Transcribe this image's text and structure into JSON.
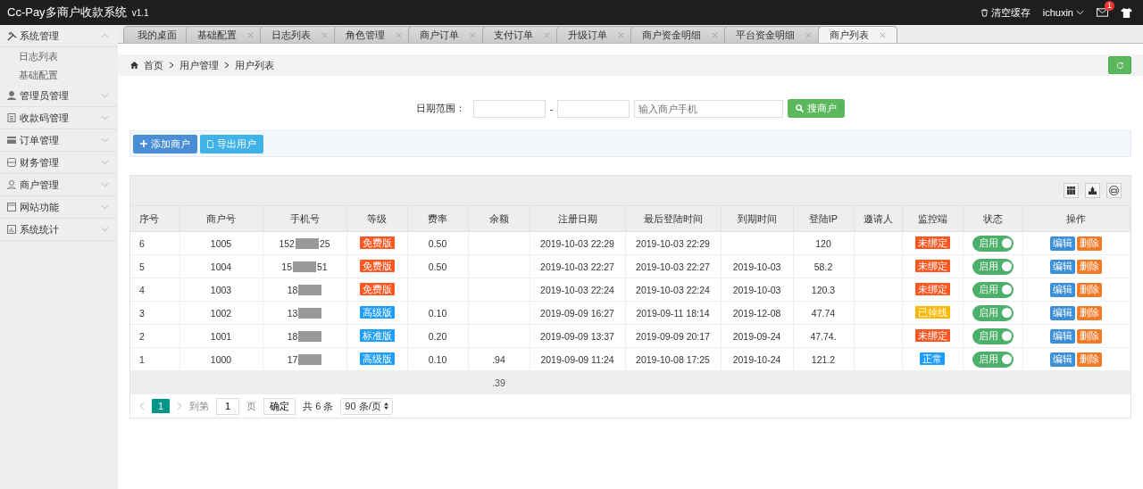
{
  "topbar": {
    "title": "Cc-Pay多商户收款系统",
    "version": "v1.1",
    "clear_cache": "清空缓存",
    "user": "ichuxin",
    "mail_badge": "1"
  },
  "sidebar": {
    "items": [
      {
        "label": "系统管理",
        "kind": "tools",
        "expanded": true,
        "children": [
          {
            "label": "日志列表"
          },
          {
            "label": "基础配置"
          }
        ]
      },
      {
        "label": "管理员管理",
        "kind": "person",
        "expanded": false
      },
      {
        "label": "收款码管理",
        "kind": "doc",
        "expanded": false
      },
      {
        "label": "订单管理",
        "kind": "card",
        "expanded": false
      },
      {
        "label": "财务管理",
        "kind": "db",
        "expanded": false
      },
      {
        "label": "商户管理",
        "kind": "person2",
        "expanded": false
      },
      {
        "label": "网站功能",
        "kind": "window",
        "expanded": false
      },
      {
        "label": "系统统计",
        "kind": "chart",
        "expanded": false
      }
    ]
  },
  "tabs": [
    {
      "label": "我的桌面",
      "closable": false,
      "selected": false
    },
    {
      "label": "基础配置",
      "closable": true,
      "selected": false
    },
    {
      "label": "日志列表",
      "closable": true,
      "selected": false
    },
    {
      "label": "角色管理",
      "closable": true,
      "selected": false
    },
    {
      "label": "商户订单",
      "closable": true,
      "selected": false
    },
    {
      "label": "支付订单",
      "closable": true,
      "selected": false
    },
    {
      "label": "升级订单",
      "closable": true,
      "selected": false
    },
    {
      "label": "商户资金明细",
      "closable": true,
      "selected": false
    },
    {
      "label": "平台资金明细",
      "closable": true,
      "selected": false
    },
    {
      "label": "商户列表",
      "closable": true,
      "selected": true
    }
  ],
  "breadcrumb": [
    "首页",
    "用户管理",
    "用户列表"
  ],
  "search": {
    "label": "日期范围：",
    "dash": "-",
    "phone_placeholder": "输入商户手机",
    "button": "搜商户"
  },
  "actions": [
    "添加商户",
    "导出用户"
  ],
  "table": {
    "columns": [
      "序号",
      "商户号",
      "手机号",
      "等级",
      "费率",
      "余额",
      "注册日期",
      "最后登陆时间",
      "到期时间",
      "登陆IP",
      "邀请人",
      "监控端",
      "状态",
      "操作"
    ],
    "rows": [
      {
        "no": "6",
        "id": "1005",
        "phone": "152",
        "phone_end": "25",
        "level": {
          "label": "免费版",
          "color": "#ff5722"
        },
        "rate": "0.50",
        "balance": "",
        "registered": "2019-10-03 22:29",
        "last_login": "2019-10-03 22:29",
        "expires": "",
        "ip": "120",
        "monitor": {
          "label": "未绑定",
          "color": "#ff5722"
        },
        "status": "启用",
        "on": true,
        "actions": [
          "编辑",
          "删除"
        ]
      },
      {
        "no": "5",
        "id": "1004",
        "phone": "15",
        "phone_end": "51",
        "level": {
          "label": "免费版",
          "color": "#ff5722"
        },
        "rate": "0.50",
        "balance": "",
        "registered": "2019-10-03 22:27",
        "last_login": "2019-10-03 22:27",
        "expires": "2019-10-03",
        "ip": "58.2",
        "monitor": {
          "label": "未绑定",
          "color": "#ff5722"
        },
        "status": "启用",
        "on": true,
        "actions": [
          "编辑",
          "删除"
        ]
      },
      {
        "no": "4",
        "id": "1003",
        "phone": "18",
        "phone_end": "",
        "level": {
          "label": "免费版",
          "color": "#ff5722"
        },
        "rate": "",
        "balance": "",
        "registered": "2019-10-03 22:24",
        "last_login": "2019-10-03 22:24",
        "expires": "2019-10-03",
        "ip": "120.3",
        "monitor": {
          "label": "未绑定",
          "color": "#ff5722"
        },
        "status": "启用",
        "on": true,
        "actions": [
          "编辑",
          "删除"
        ]
      },
      {
        "no": "3",
        "id": "1002",
        "phone": "13",
        "phone_end": "",
        "level": {
          "label": "高级版",
          "color": "#1e9fff"
        },
        "rate": "0.10",
        "balance": "",
        "registered": "2019-09-09 16:27",
        "last_login": "2019-09-11 18:14",
        "expires": "2019-12-08",
        "ip": "47.74",
        "monitor": {
          "label": "已掉线",
          "color": "#ffb800"
        },
        "status": "启用",
        "on": true,
        "actions": [
          "编辑",
          "删除"
        ]
      },
      {
        "no": "2",
        "id": "1001",
        "phone": "18",
        "phone_end": "",
        "level": {
          "label": "标准版",
          "color": "#1e9fff"
        },
        "rate": "0.20",
        "balance": "",
        "registered": "2019-09-09 13:37",
        "last_login": "2019-09-09 20:17",
        "expires": "2019-09-24",
        "ip": "47.74.",
        "monitor": {
          "label": "未绑定",
          "color": "#ff5722"
        },
        "status": "启用",
        "on": true,
        "actions": [
          "编辑",
          "删除"
        ]
      },
      {
        "no": "1",
        "id": "1000",
        "phone": "17",
        "phone_end": "",
        "level": {
          "label": "高级版",
          "color": "#1e9fff"
        },
        "rate": "0.10",
        "balance": ".94",
        "registered": "2019-09-09 11:24",
        "last_login": "2019-10-08 17:25",
        "expires": "2019-10-24",
        "ip": "121.2",
        "monitor": {
          "label": "正常",
          "color": "#1e9fff"
        },
        "status": "启用",
        "on": true,
        "actions": [
          "编辑",
          "删除"
        ]
      }
    ],
    "total_balance": ".39"
  },
  "pagination": {
    "pages": [
      {
        "label": "1",
        "selected": true
      }
    ],
    "goto": "到第",
    "page_input": "1",
    "page_unit": "页",
    "confirm": "确定",
    "total": "共 6 条",
    "per_page": "90 条/页"
  }
}
